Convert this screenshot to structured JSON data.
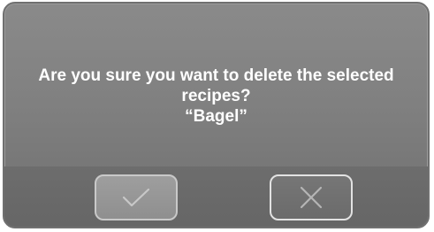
{
  "dialog": {
    "message_line1": "Are you sure you want to delete the selected",
    "message_line2": "recipes?",
    "item_name": "“Bagel”",
    "confirm_icon": "check-icon",
    "cancel_icon": "close-icon"
  },
  "colors": {
    "panel": "#808080",
    "text": "#ffffff",
    "button_border": "#d8d8d8"
  }
}
